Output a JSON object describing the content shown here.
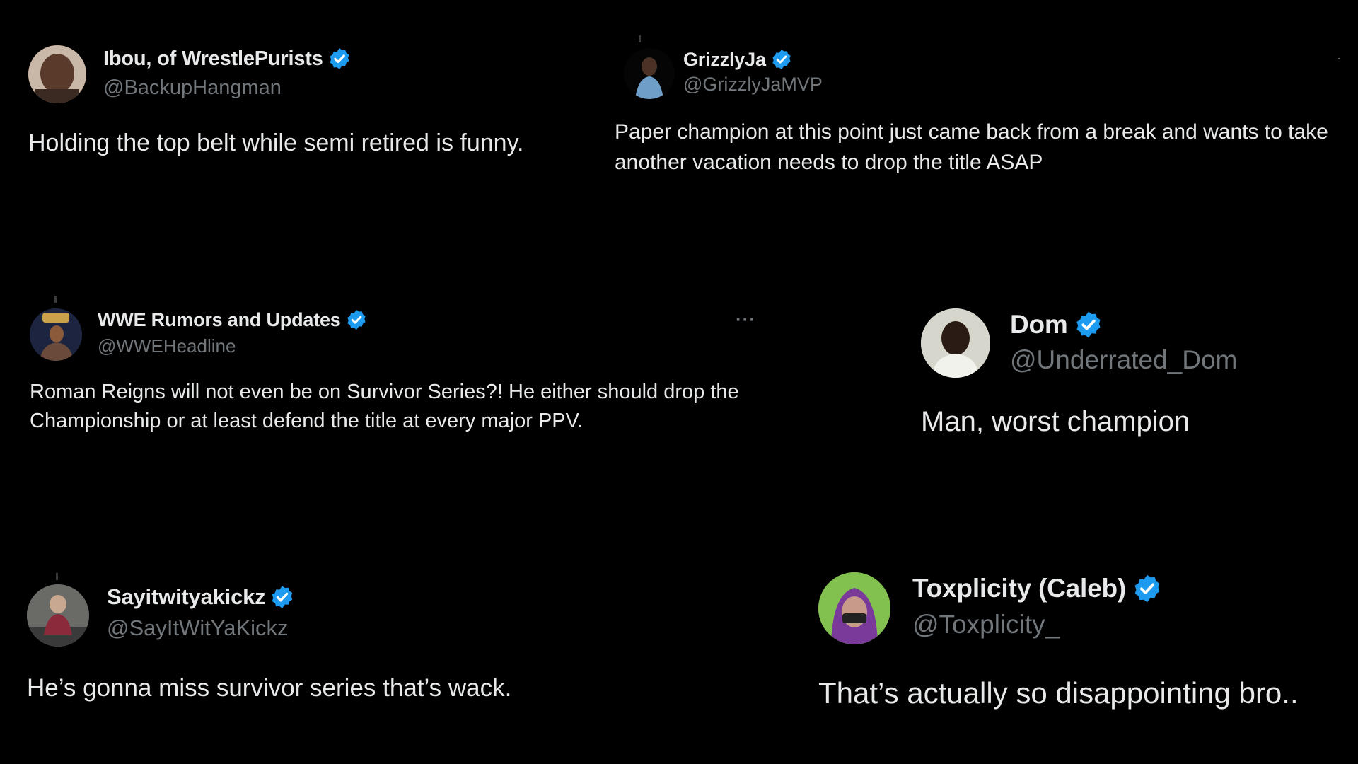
{
  "colors": {
    "background": "#000000",
    "text_primary": "#e7e9ea",
    "text_secondary": "#71767b",
    "verified_blue": "#1d9bf0"
  },
  "tweets": [
    {
      "display_name": "Ibou, of WrestlePurists",
      "handle": "@BackupHangman",
      "text": "Holding the top belt while semi retired is funny.",
      "verified_icon": "verified-badge-icon"
    },
    {
      "display_name": "GrizzlyJa",
      "handle": "@GrizzlyJaMVP",
      "text": "Paper champion at this point just came back from a break and wants to take another vacation needs to drop the title ASAP",
      "verified_icon": "verified-badge-icon"
    },
    {
      "display_name": "WWE Rumors and Updates",
      "handle": "@WWEHeadline",
      "text": "Roman Reigns will not even be on Survivor Series?! He either should drop the Championship or at least defend the title at every major PPV.",
      "more_label": "···",
      "verified_icon": "verified-badge-icon"
    },
    {
      "display_name": "Dom",
      "handle": "@Underrated_Dom",
      "text": "Man, worst champion",
      "verified_icon": "verified-badge-icon"
    },
    {
      "display_name": "Sayitwityakickz",
      "handle": "@SayItWitYaKickz",
      "text": "He’s gonna miss survivor series that’s wack.",
      "verified_icon": "verified-badge-icon"
    },
    {
      "display_name": "Toxplicity (Caleb)",
      "handle": "@Toxplicity_",
      "text": "That’s actually so disappointing bro..",
      "verified_icon": "verified-badge-icon"
    }
  ]
}
